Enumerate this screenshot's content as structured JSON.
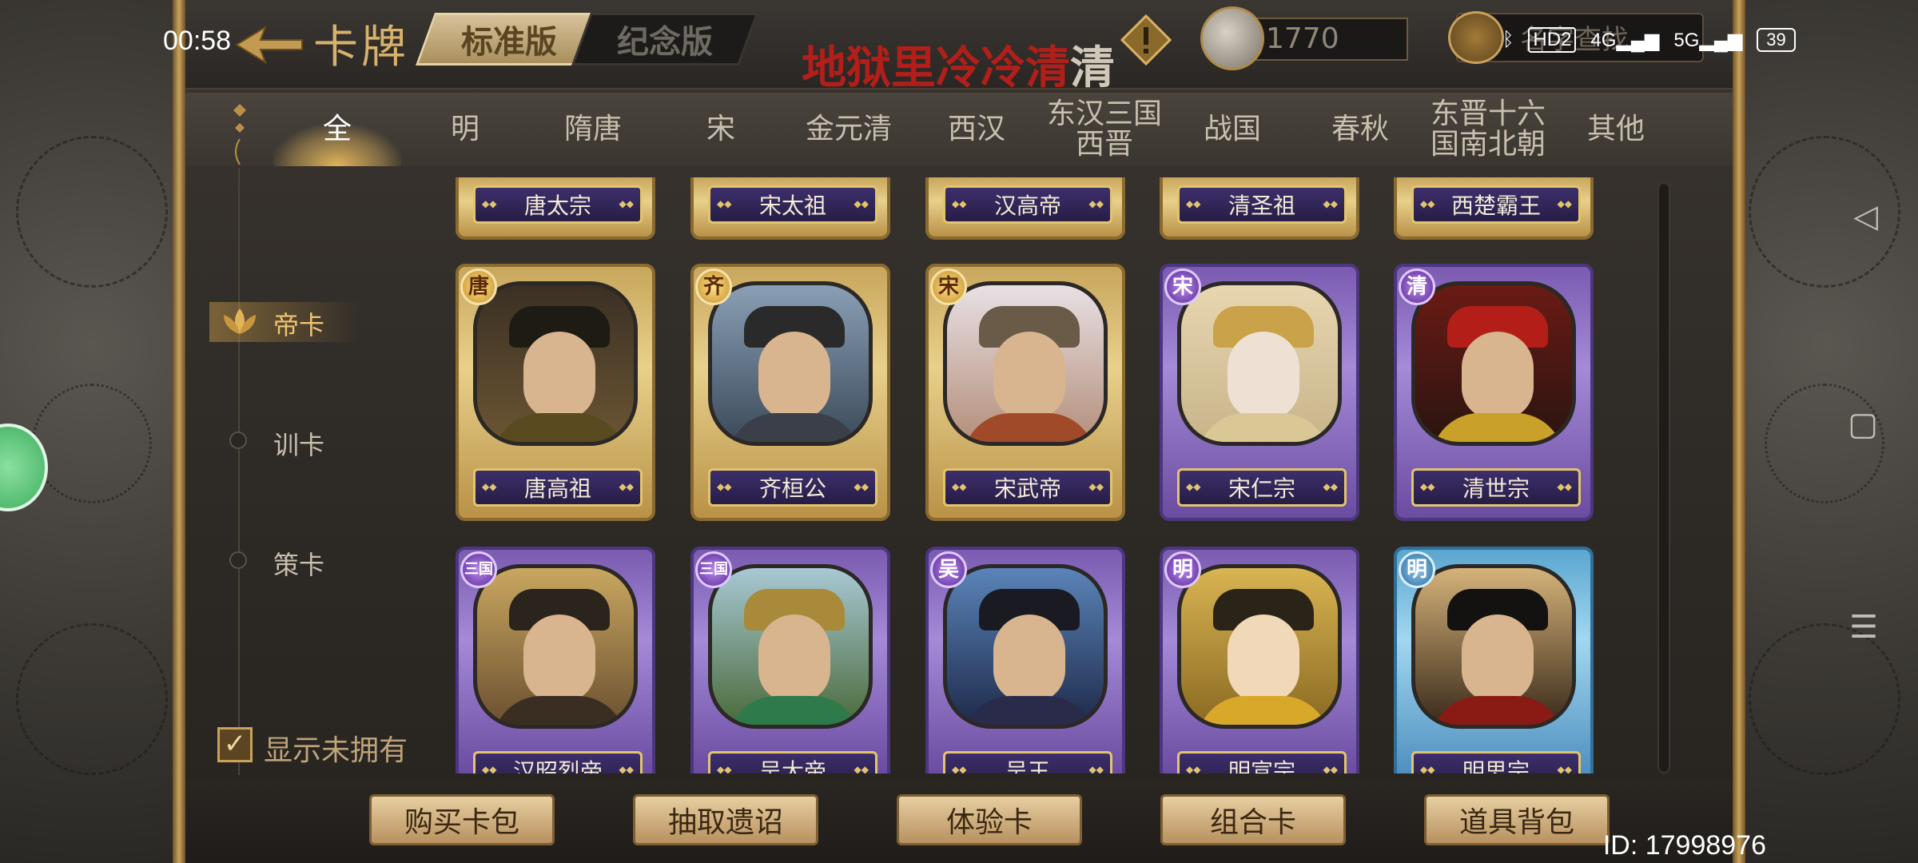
{
  "status_bar": {
    "time": "00:58",
    "hd_label": "HD2",
    "net1": "4G",
    "net2": "5G",
    "battery": "39"
  },
  "header": {
    "title": "卡牌",
    "version_tabs": [
      "标准版",
      "纪念版"
    ],
    "active_version": "标准版",
    "currency_value": "1770",
    "search_placeholder": "名字查找",
    "overlay_title_red": "地狱里冷冷清",
    "overlay_title_tail": "清"
  },
  "categories": [
    {
      "label": "全"
    },
    {
      "label": "明"
    },
    {
      "label": "隋唐"
    },
    {
      "label": "宋"
    },
    {
      "label": "金元清"
    },
    {
      "label": "西汉"
    },
    {
      "label": "东汉三国\n西晋"
    },
    {
      "label": "战国"
    },
    {
      "label": "春秋"
    },
    {
      "label": "东晋十六\n国南北朝"
    },
    {
      "label": "其他"
    }
  ],
  "active_category": "全",
  "sidebar": {
    "items": [
      {
        "label": "帝卡"
      },
      {
        "label": "训卡"
      },
      {
        "label": "策卡"
      }
    ],
    "active_item": "帝卡",
    "show_unowned_label": "显示未拥有",
    "show_unowned_checked": true
  },
  "cards": {
    "row0": [
      {
        "name": "唐太宗"
      },
      {
        "name": "宋太祖"
      },
      {
        "name": "汉高帝"
      },
      {
        "name": "清圣祖"
      },
      {
        "name": "西楚霸王"
      }
    ],
    "row1": [
      {
        "name": "唐高祖",
        "dynasty": "唐",
        "rarity": "gold"
      },
      {
        "name": "齐桓公",
        "dynasty": "齐",
        "rarity": "gold"
      },
      {
        "name": "宋武帝",
        "dynasty": "宋",
        "rarity": "gold"
      },
      {
        "name": "宋仁宗",
        "dynasty": "宋",
        "rarity": "purple"
      },
      {
        "name": "清世宗",
        "dynasty": "清",
        "rarity": "purple"
      }
    ],
    "row2": [
      {
        "name": "汉昭烈帝",
        "dynasty": "三国",
        "rarity": "purple"
      },
      {
        "name": "吴大帝",
        "dynasty": "三国",
        "rarity": "purple"
      },
      {
        "name": "吴王",
        "dynasty": "吴",
        "rarity": "purple"
      },
      {
        "name": "明宣宗",
        "dynasty": "明",
        "rarity": "purple"
      },
      {
        "name": "明思宗",
        "dynasty": "明",
        "rarity": "blue"
      }
    ]
  },
  "bottom_buttons": [
    {
      "label": "购买卡包"
    },
    {
      "label": "抽取遗诏"
    },
    {
      "label": "体验卡"
    },
    {
      "label": "组合卡"
    },
    {
      "label": "道具背包"
    }
  ],
  "user_id": "ID: 17998976",
  "colors": {
    "gold_accent": "#d8b26b",
    "overlay_red": "#b21f1a",
    "card_gold": "#e8d08b",
    "card_purple": "#a58ad8",
    "card_blue": "#a2d7ef"
  },
  "icons": [
    "back-arrow-icon",
    "warning-icon",
    "currency-helmet-icon",
    "search-icon",
    "lotus-icon",
    "checkbox-icon",
    "bluetooth-icon",
    "signal-icon",
    "battery-icon",
    "nav-back-icon",
    "nav-home-icon",
    "nav-menu-icon"
  ]
}
